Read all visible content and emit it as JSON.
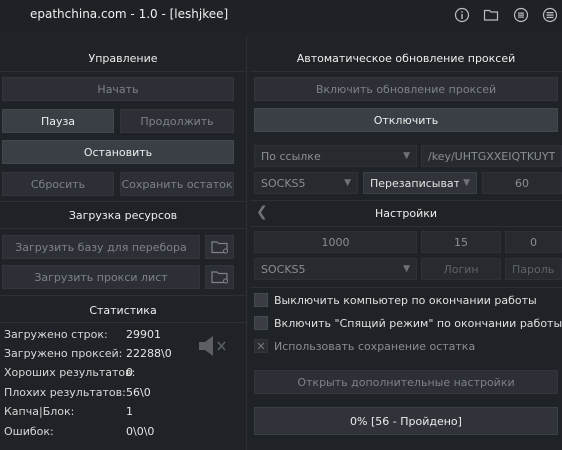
{
  "window": {
    "title": "epathchina.com - 1.0 - [leshjkee]"
  },
  "titlebar_icons": [
    "info-icon",
    "folder-icon",
    "list-icon",
    "menu-icon"
  ],
  "management": {
    "header": "Управление",
    "start": "Начать",
    "pause": "Пауза",
    "resume": "Продолжить",
    "stop": "Остановить",
    "reset": "Сбросить",
    "save_rest": "Сохранить остаток"
  },
  "resources": {
    "header": "Загрузка ресурсов",
    "load_base": "Загрузить базу для перебора",
    "load_proxy": "Загрузить прокси лист"
  },
  "stats": {
    "header": "Статистика",
    "rows": [
      {
        "label": "Загружено строк:",
        "value": "29901"
      },
      {
        "label": "Загружено проксей:",
        "value": "22288\\0"
      },
      {
        "label": "Хороших результатов:",
        "value": "0"
      },
      {
        "label": "Плохих результатов:",
        "value": "56\\0"
      },
      {
        "label": "Капча|Блок:",
        "value": "1"
      },
      {
        "label": "Ошибок:",
        "value": "0\\0\\0"
      }
    ]
  },
  "proxy_update": {
    "header": "Автоматическое обновление проксей",
    "enable": "Включить обновление проксей",
    "disable": "Отключить",
    "source": "По ссылке",
    "url": "/key/UHTGXXEIQTKUYTMM",
    "type": "SOCKS5",
    "mode": "Перезаписывать",
    "interval": "60"
  },
  "settings": {
    "header": "Настройки",
    "threads": "1000",
    "timeout": "15",
    "retries": "0",
    "proxy_type": "SOCKS5",
    "login_placeholder": "Логин",
    "password_placeholder": "Пароль",
    "opt_shutdown": "Выключить компьютер по окончании работы",
    "opt_sleep": "Включить \"Спящий режим\" по окончании работы",
    "opt_save_rest": "Использовать сохранение остатка",
    "more_settings": "Открыть дополнительные настройки"
  },
  "progress": {
    "text": "0% [56 - Пройдено]",
    "fraction": 0.0
  }
}
